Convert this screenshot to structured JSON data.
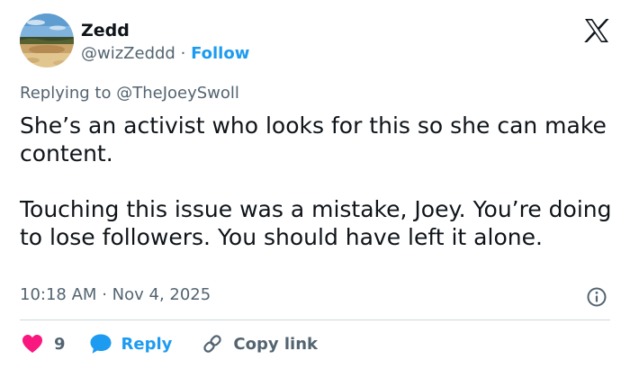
{
  "author": {
    "display_name": "Zedd",
    "handle": "@wizZeddd",
    "separator": "·",
    "follow_label": "Follow"
  },
  "reply_context": {
    "prefix": "Replying to",
    "mention": "@TheJoeySwoll"
  },
  "tweet": {
    "paragraphs": [
      "She’s an activist who looks for this so she can make content.",
      "Touching this issue was a mistake, Joey. You’re doing to lose followers. You should have left it alone."
    ],
    "time": "10:18 AM",
    "date_separator": "·",
    "date": "Nov 4, 2025"
  },
  "actions": {
    "like_count": "9",
    "reply_label": "Reply",
    "copy_label": "Copy link"
  },
  "icons": {
    "brand": "x-logo-icon",
    "info": "info-icon",
    "like": "heart-icon",
    "reply": "speech-bubble-icon",
    "copy": "link-icon"
  },
  "colors": {
    "accent_blue": "#1d9bf0",
    "like_pink": "#f91880",
    "muted_text": "#536471",
    "primary_text": "#0f1419",
    "divider": "#cfd9de"
  }
}
